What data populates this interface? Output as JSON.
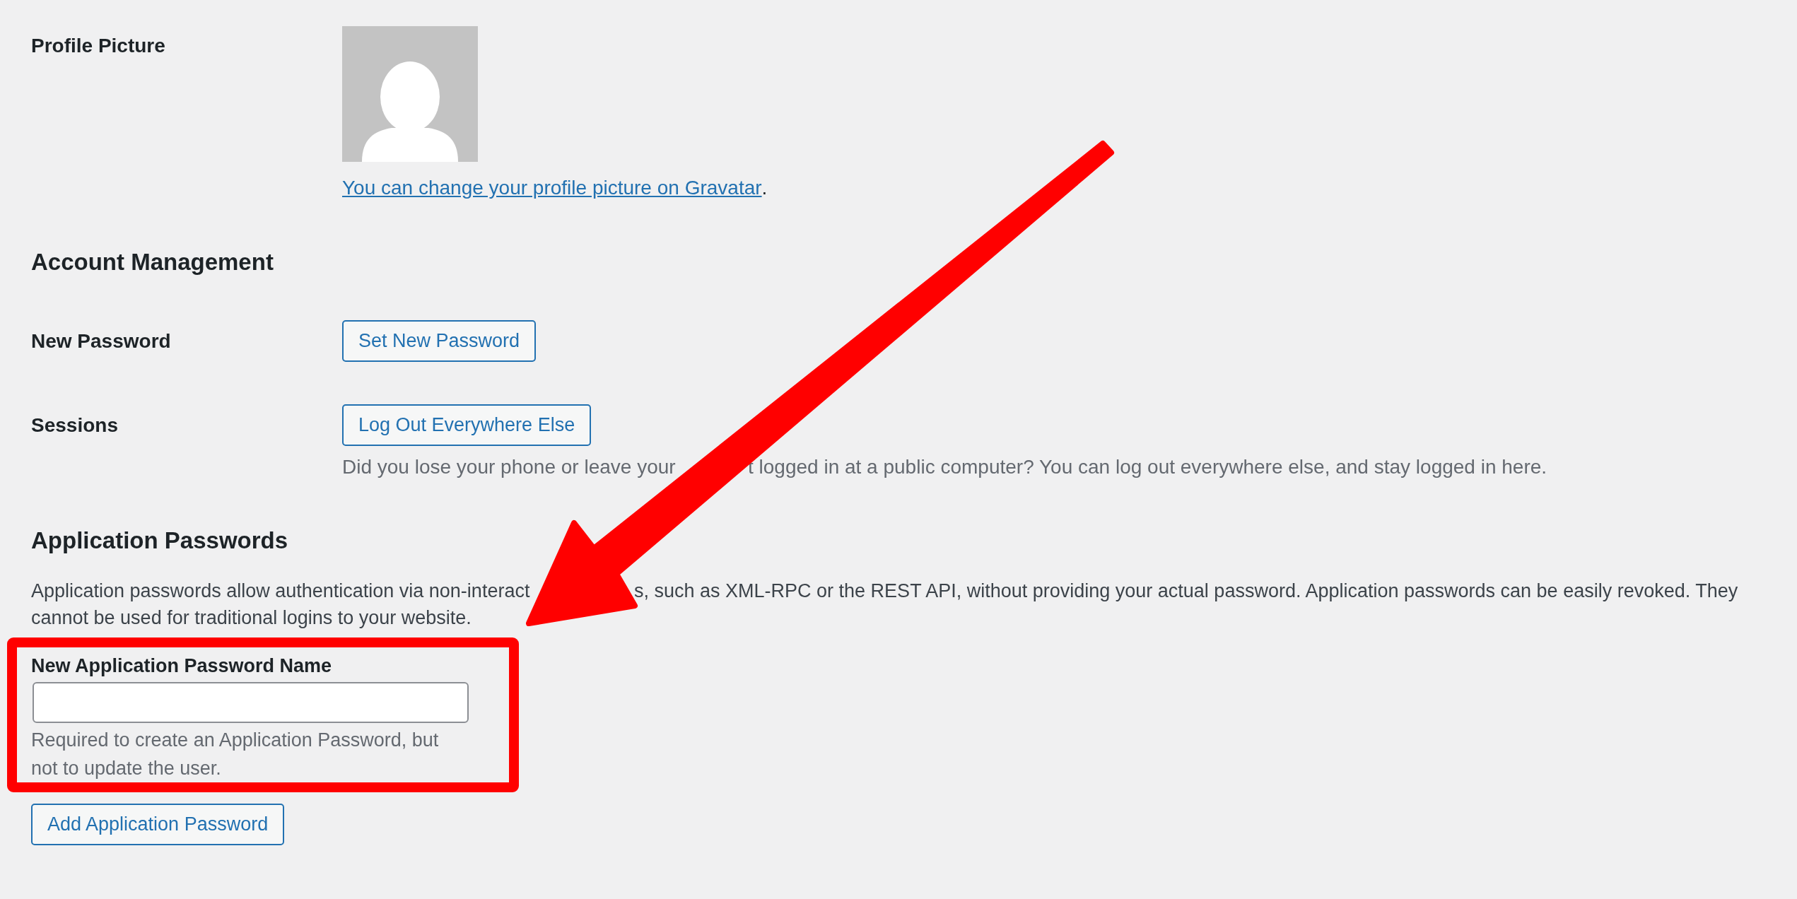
{
  "profile_picture": {
    "label": "Profile Picture",
    "link": "You can change your profile picture on Gravatar",
    "link_suffix": "."
  },
  "account_management": {
    "heading": "Account Management",
    "rows": [
      {
        "label": "New Password",
        "button": "Set New Password"
      },
      {
        "label": "Sessions",
        "button": "Log Out Everywhere Else",
        "description_parts": [
          "Did you lose your phone or leave your",
          "t logged in at a public computer? You can log out everywhere else, and stay logged in here."
        ]
      }
    ]
  },
  "application_passwords": {
    "heading": "Application Passwords",
    "description_lines": [
      [
        "Application passwords allow authentication via non-interact",
        "s, such as XML-RPC or the REST API, without providing your actual password. Application passwords can be easily revoked. They"
      ],
      [
        "cannot be used for traditional logins to your website."
      ]
    ],
    "field": {
      "label": "New Application Password Name",
      "help": "Required to create an Application Password, but not to update the user."
    },
    "button": "Add Application Password"
  }
}
